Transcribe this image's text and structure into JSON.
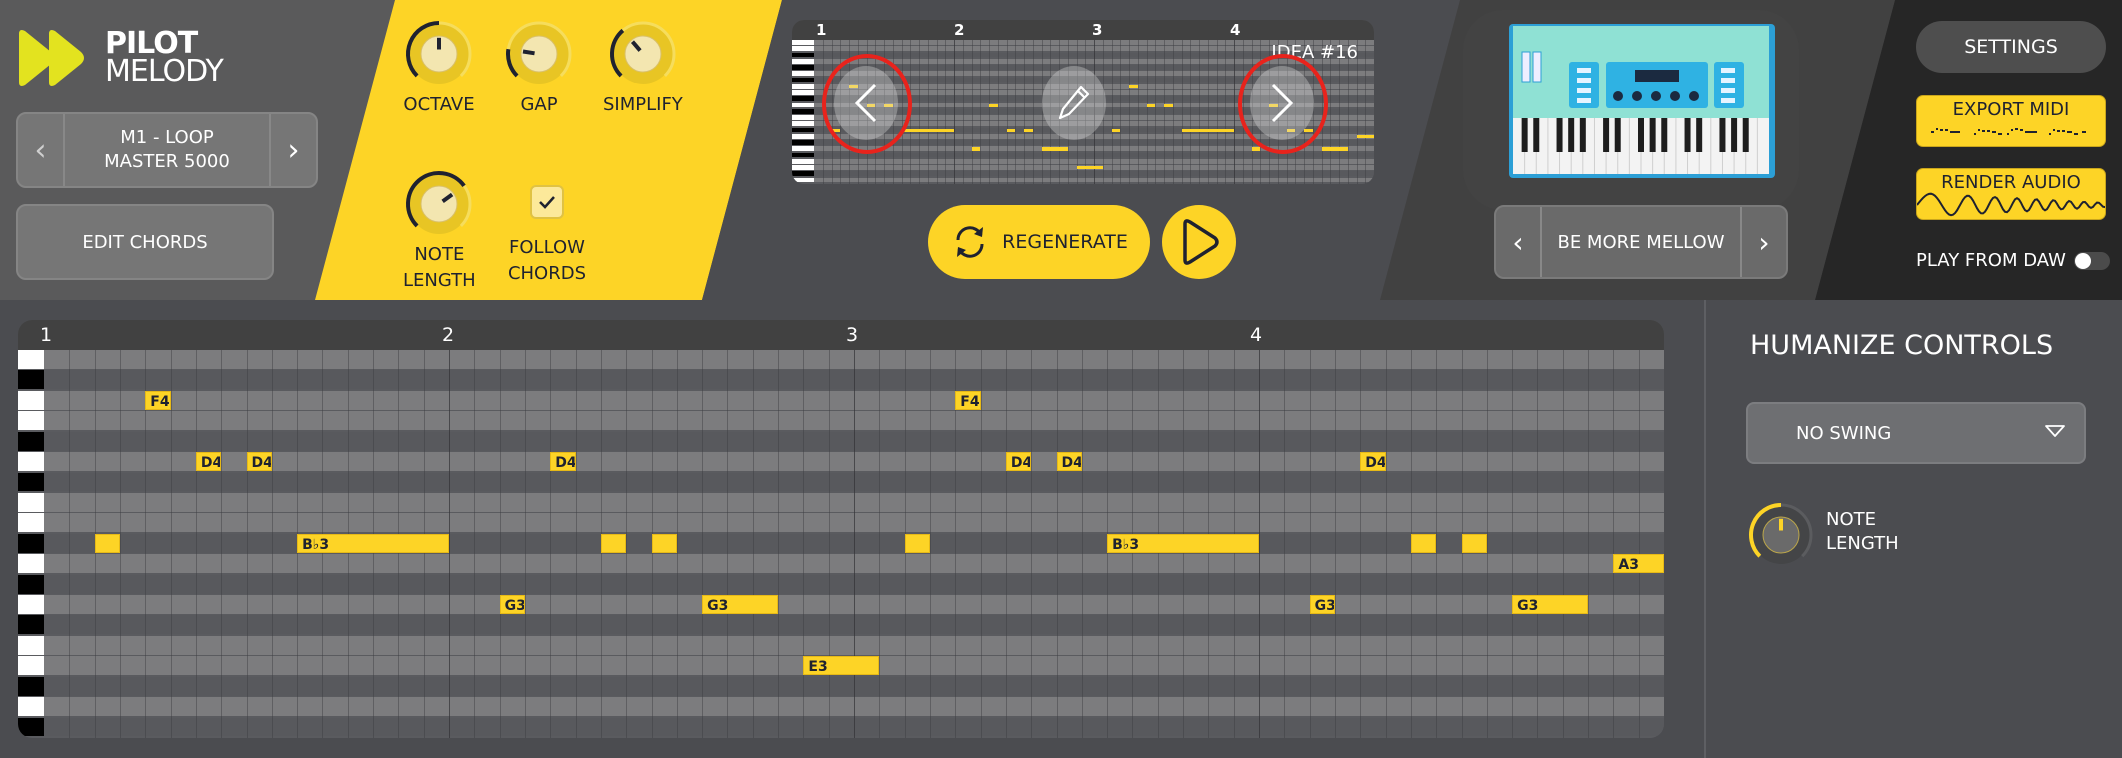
{
  "app": {
    "logo_line1": "PILOT",
    "logo_line2": "MELODY",
    "accent_color": "#fdd426",
    "logo_color": "#e3e31f"
  },
  "preset": {
    "prev_icon": "chevron-left-icon",
    "line1": "M1 - LOOP",
    "line2": "MASTER 5000",
    "next_icon": "chevron-right-icon"
  },
  "edit_chords_label": "EDIT CHORDS",
  "controls": {
    "knobs": [
      {
        "id": "octave",
        "label_line1": "OCTAVE",
        "label_line2": "",
        "value": 0.5
      },
      {
        "id": "gap",
        "label_line1": "GAP",
        "label_line2": "",
        "value": 0.2
      },
      {
        "id": "simplify",
        "label_line1": "SIMPLIFY",
        "label_line2": "",
        "value": 0.35
      },
      {
        "id": "note-length",
        "label_line1": "NOTE",
        "label_line2": "LENGTH",
        "value": 0.7
      }
    ],
    "follow_chords": {
      "label_line1": "FOLLOW",
      "label_line2": "CHORDS",
      "checked": true
    }
  },
  "preview": {
    "bars": [
      "1",
      "2",
      "3",
      "4"
    ],
    "idea_label": "IDEA #16",
    "prev_icon": "chevron-left-icon",
    "edit_icon": "pencil-icon",
    "next_icon": "chevron-right-icon"
  },
  "regenerate_label": "REGENERATE",
  "play_icon": "play-icon",
  "instrument": {
    "image": "synth-keyboard-illustration",
    "mood_label": "BE MORE MELLOW"
  },
  "actions": {
    "settings_label": "SETTINGS",
    "export_midi_label": "EXPORT MIDI",
    "render_audio_label": "RENDER AUDIO",
    "play_from_daw_label": "PLAY FROM DAW",
    "play_from_daw_on": false
  },
  "piano_roll": {
    "bars": [
      "1",
      "2",
      "3",
      "4"
    ],
    "steps_per_bar": 16,
    "rows": [
      {
        "pitch": "G4",
        "black": false
      },
      {
        "pitch": "F#4",
        "black": true
      },
      {
        "pitch": "F4",
        "black": false
      },
      {
        "pitch": "E4",
        "black": false
      },
      {
        "pitch": "Eb4",
        "black": true
      },
      {
        "pitch": "D4",
        "black": false
      },
      {
        "pitch": "C#4",
        "black": true
      },
      {
        "pitch": "C4",
        "black": false
      },
      {
        "pitch": "B3",
        "black": false
      },
      {
        "pitch": "Bb3",
        "black": true
      },
      {
        "pitch": "A3",
        "black": false
      },
      {
        "pitch": "G#3",
        "black": true
      },
      {
        "pitch": "G3",
        "black": false
      },
      {
        "pitch": "F#3",
        "black": true
      },
      {
        "pitch": "F3",
        "black": false
      },
      {
        "pitch": "E3",
        "black": false
      },
      {
        "pitch": "Eb3",
        "black": true
      },
      {
        "pitch": "D3",
        "black": false
      },
      {
        "pitch": "Db3",
        "black": true
      }
    ],
    "notes": [
      {
        "pitch": "Bb3",
        "label": "",
        "start": 2,
        "length": 1
      },
      {
        "pitch": "F4",
        "label": "F4",
        "start": 4,
        "length": 1
      },
      {
        "pitch": "D4",
        "label": "D4",
        "start": 6,
        "length": 1
      },
      {
        "pitch": "D4",
        "label": "D4",
        "start": 8,
        "length": 1
      },
      {
        "pitch": "Bb3",
        "label": "B♭3",
        "start": 10,
        "length": 6
      },
      {
        "pitch": "G3",
        "label": "G3",
        "start": 18,
        "length": 1
      },
      {
        "pitch": "D4",
        "label": "D4",
        "start": 20,
        "length": 1
      },
      {
        "pitch": "Bb3",
        "label": "",
        "start": 22,
        "length": 1
      },
      {
        "pitch": "Bb3",
        "label": "",
        "start": 24,
        "length": 1
      },
      {
        "pitch": "G3",
        "label": "G3",
        "start": 26,
        "length": 3
      },
      {
        "pitch": "E3",
        "label": "E3",
        "start": 30,
        "length": 3
      },
      {
        "pitch": "Bb3",
        "label": "",
        "start": 34,
        "length": 1
      },
      {
        "pitch": "F4",
        "label": "F4",
        "start": 36,
        "length": 1
      },
      {
        "pitch": "D4",
        "label": "D4",
        "start": 38,
        "length": 1
      },
      {
        "pitch": "D4",
        "label": "D4",
        "start": 40,
        "length": 1
      },
      {
        "pitch": "Bb3",
        "label": "B♭3",
        "start": 42,
        "length": 6
      },
      {
        "pitch": "G3",
        "label": "G3",
        "start": 50,
        "length": 1
      },
      {
        "pitch": "D4",
        "label": "D4",
        "start": 52,
        "length": 1
      },
      {
        "pitch": "Bb3",
        "label": "",
        "start": 54,
        "length": 1
      },
      {
        "pitch": "Bb3",
        "label": "",
        "start": 56,
        "length": 1
      },
      {
        "pitch": "G3",
        "label": "G3",
        "start": 58,
        "length": 3
      },
      {
        "pitch": "A3",
        "label": "A3",
        "start": 62,
        "length": 2
      }
    ]
  },
  "humanize": {
    "title": "HUMANIZE CONTROLS",
    "swing_value": "NO SWING",
    "note_length_line1": "NOTE",
    "note_length_line2": "LENGTH",
    "note_length_value": 0.5
  }
}
